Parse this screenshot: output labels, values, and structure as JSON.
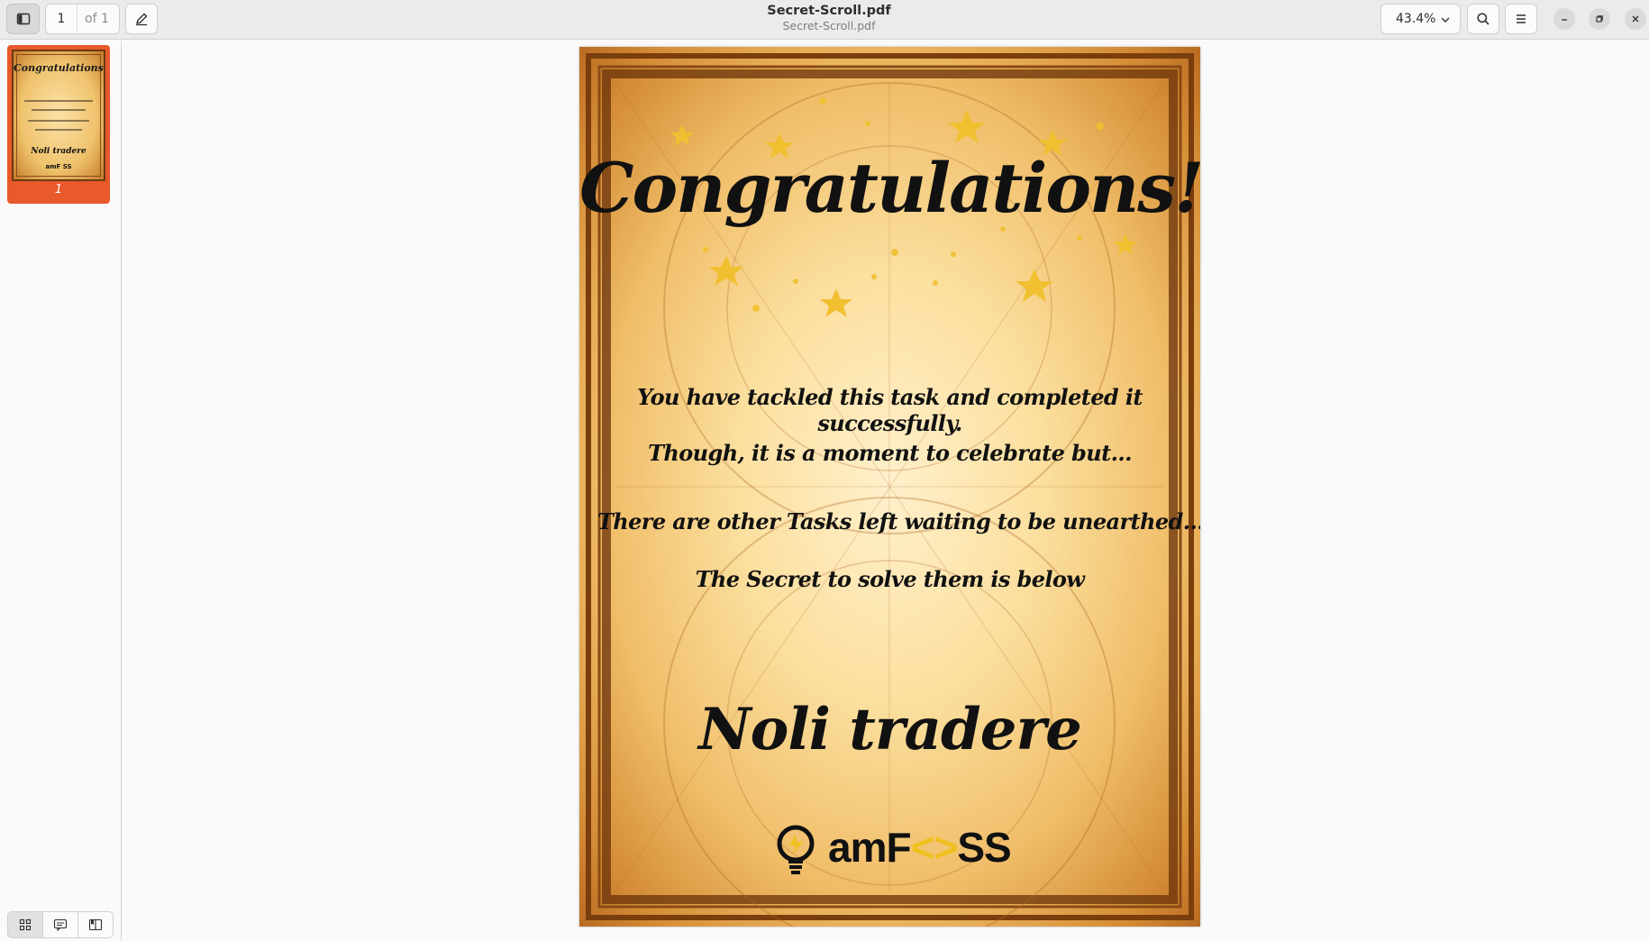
{
  "header": {
    "title": "Secret-Scroll.pdf",
    "subtitle": "Secret-Scroll.pdf",
    "page_current": "1",
    "page_of": "of 1",
    "zoom": "43.4%"
  },
  "sidebar": {
    "thumbnail": {
      "page_number": "1",
      "title": "Congratulations!",
      "signature": "Noli tradere",
      "logo": "amF SS"
    }
  },
  "document": {
    "title": "Congratulations!",
    "lines": [
      "You have tackled this task and completed it successfully.",
      "Though, it is a moment to celebrate but...",
      "There are other Tasks left waiting to be unearthed...",
      "The Secret to solve them is below"
    ],
    "signature": "Noli tradere",
    "logo": {
      "prefix": "amF",
      "suffix": "SS"
    }
  },
  "icons": {
    "sidebar_toggle": "sidebar-toggle-icon",
    "annotate": "pencil-icon",
    "zoom_dropdown": "chevron-down-icon",
    "search": "search-icon",
    "menu": "hamburger-menu-icon",
    "minimize": "minimize-icon",
    "maximize": "restore-icon",
    "close": "close-icon",
    "thumbnails_view": "grid-icon",
    "annotations_view": "annotation-icon",
    "bookmarks_view": "bookmark-icon"
  },
  "colors": {
    "accent": "#e8592b",
    "header_bg": "#ebebeb",
    "logo_yellow": "#f0c020"
  }
}
